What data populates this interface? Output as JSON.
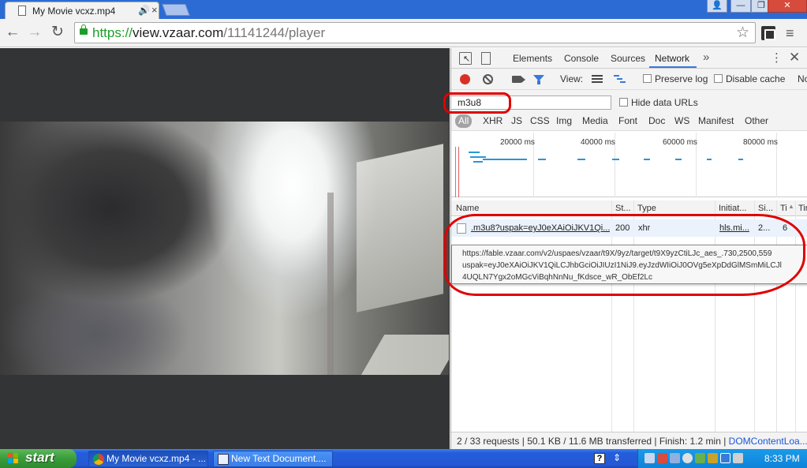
{
  "browser": {
    "tab_title": "My Movie vcxz.mp4",
    "url_scheme": "https://",
    "url_host": "view.vzaar.com",
    "url_path": "/11141244/player",
    "window_buttons": {
      "profile": "👤",
      "minimize": "—",
      "restore": "❐",
      "close": "✕"
    },
    "nav": {
      "back": "←",
      "forward": "→",
      "reload": "↻",
      "star": "☆",
      "menu": "≡",
      "tab_close": "×",
      "audio": "🔊"
    }
  },
  "devtools": {
    "tabs": [
      {
        "label": "Elements"
      },
      {
        "label": "Console"
      },
      {
        "label": "Sources"
      },
      {
        "label": "Network",
        "active": true
      }
    ],
    "more_tabs": "»",
    "kebab": "⋮",
    "close": "✕",
    "toolbar": {
      "view_label": "View:",
      "preserve_log": "Preserve log",
      "disable_cache": "Disable cache",
      "offline_truncated": "No"
    },
    "filter": {
      "value": "m3u8",
      "hide_data_urls": "Hide data URLs",
      "types": [
        "All",
        "XHR",
        "JS",
        "CSS",
        "Img",
        "Media",
        "Font",
        "Doc",
        "WS",
        "Manifest",
        "Other"
      ],
      "active_type": "All"
    },
    "overview_ticks": [
      "20000 ms",
      "40000 ms",
      "60000 ms",
      "80000 ms"
    ],
    "columns": [
      "Name",
      "St...",
      "Type",
      "Initiat...",
      "Si...",
      "Ti",
      "Tir"
    ],
    "sort_indicator": "▲",
    "rows": [
      {
        "name": ".m3u8?uspak=eyJ0eXAiOiJKV1Qi...",
        "status": "200",
        "type": "xhr",
        "initiator": "hls.mi...",
        "size": "2...",
        "time": "6"
      },
      {
        "name": "...",
        "status": "",
        "type": "",
        "initiator": "",
        "size": "",
        "time": ""
      }
    ],
    "tooltip_lines": [
      "https://fable.vzaar.com/v2/uspaes/vzaar/t9X/9yz/target/t9X9yzCtiLJc_aes_.730,2500,559",
      "uspak=eyJ0eXAiOiJKV1QiLCJhbGciOiJIUzI1NiJ9.eyJzdWIiOiJ0OVg5eXpDdGlMSmMiLCJl",
      "4UQLN7Ygx2oMGcViBqhNnNu_fKdsce_wR_ObEf2Lc"
    ],
    "status": {
      "requests": "2 / 33 requests",
      "transferred": "50.1 KB / 11.6 MB transferred",
      "finish": "Finish: 1.2 min",
      "dcl": "DOMContentLoa..."
    }
  },
  "taskbar": {
    "start_label": "start",
    "buttons": [
      {
        "label": "My Movie vcxz.mp4 - ...",
        "active": true
      },
      {
        "label": "New Text Document....",
        "active": false
      }
    ],
    "help": "?",
    "tray_arrow": "⇕",
    "clock": "8:33 PM"
  },
  "colors": {
    "accent_blue": "#3879d9",
    "record_red": "#d93025",
    "annotation_red": "#e00000",
    "xp_taskbar": "#245ddb",
    "xp_start_green": "#3a9c3a",
    "secure_green": "#1d9d28"
  }
}
